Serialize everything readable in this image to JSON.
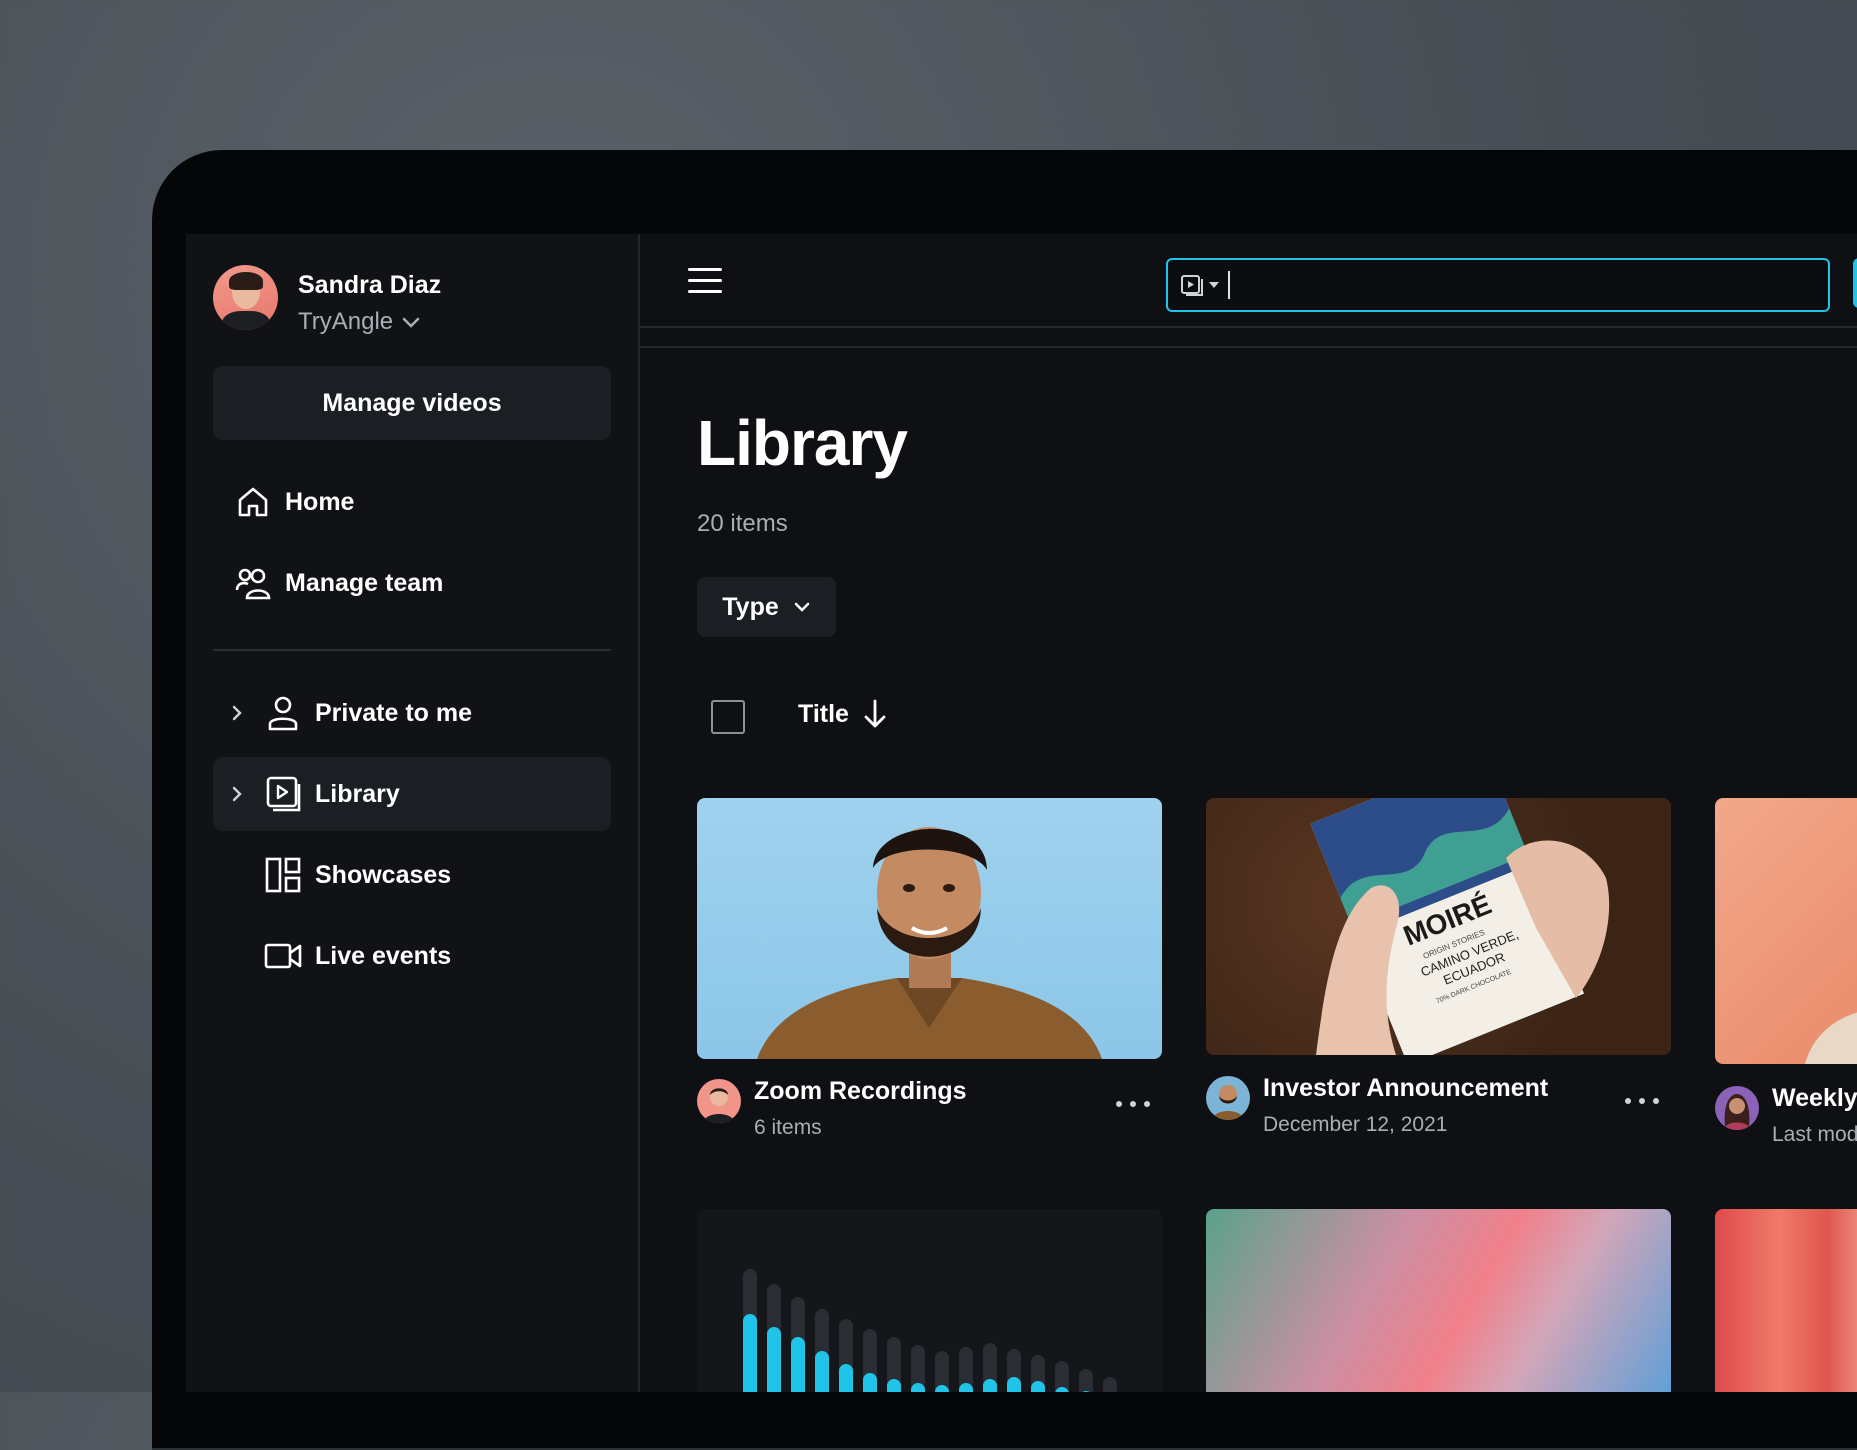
{
  "user": {
    "name": "Sandra Diaz",
    "org": "TryAngle"
  },
  "sidebar": {
    "manage_label": "Manage videos",
    "items": [
      {
        "label": "Home",
        "icon": "home-icon"
      },
      {
        "label": "Manage team",
        "icon": "team-icon"
      },
      {
        "label": "Private to me",
        "icon": "person-icon"
      },
      {
        "label": "Library",
        "icon": "library-icon"
      },
      {
        "label": "Showcases",
        "icon": "showcase-icon"
      },
      {
        "label": "Live events",
        "icon": "camera-icon"
      }
    ]
  },
  "search": {
    "value": ""
  },
  "page": {
    "title": "Library",
    "count": "20 items",
    "filter_label": "Type",
    "sort_label": "Title"
  },
  "cards": [
    {
      "title": "Zoom Recordings",
      "sub": "6 items"
    },
    {
      "title": "Investor Announcement",
      "sub": "December 12, 2021"
    },
    {
      "title": "Weekly",
      "sub": "Last mod"
    }
  ],
  "package_text": {
    "brand": "MOIRÉ",
    "lines": [
      "ORIGIN STORIES",
      "CAMINO VERDE,",
      "ECUADOR",
      "70% DARK CHOCOLATE"
    ]
  },
  "colors": {
    "accent": "#1fc4e8",
    "background": "#0e1013",
    "sidebar": "#101215"
  }
}
